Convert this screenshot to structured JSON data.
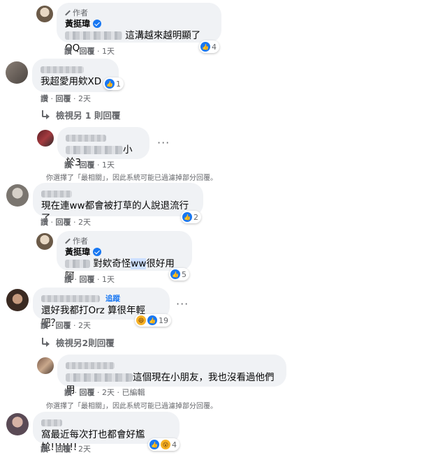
{
  "labels": {
    "author": "作者",
    "like": "讚",
    "reply": "回覆",
    "edited": "已編輯",
    "follow": "追蹤"
  },
  "filter_note": "你選擇了「最相關」，因此系統可能已過濾掉部分回覆。",
  "comments": [
    {
      "id": "c1",
      "author_badge": true,
      "name": "黃挺瑋",
      "verified": true,
      "text": "這溝越來越明顯了QQ",
      "reactions": "4",
      "time": "1天"
    },
    {
      "id": "c2",
      "text": "我超愛用欸XD",
      "reactions": "1",
      "time": "2天"
    },
    {
      "id": "c3",
      "text": "小於3",
      "time": "1天"
    },
    {
      "id": "c4",
      "text": "現在連ww都會被打草的人說退流行了",
      "reactions": "2",
      "time": "2天"
    },
    {
      "id": "c5",
      "author_badge": true,
      "name": "黃挺瑋",
      "verified": true,
      "text_before": "對欸奇怪",
      "text_highlight": "ww",
      "text_after": "很好用阿",
      "reactions": "5",
      "time": "1天"
    },
    {
      "id": "c6",
      "text": "還好我都打Orz 算很年輕吧？",
      "reactions": "19",
      "time": "2天"
    },
    {
      "id": "c7",
      "text": "這個現在小朋友，我也沒看過他們用",
      "time": "2天"
    },
    {
      "id": "c8",
      "text": "窩最近每次打也都會好尷尬!!!!!!!",
      "reactions": "4",
      "time": "2天"
    }
  ],
  "view_more": [
    {
      "id": "v1",
      "label": "檢視另 1 則回覆"
    },
    {
      "id": "v2",
      "label": "檢視另2則回覆"
    }
  ]
}
